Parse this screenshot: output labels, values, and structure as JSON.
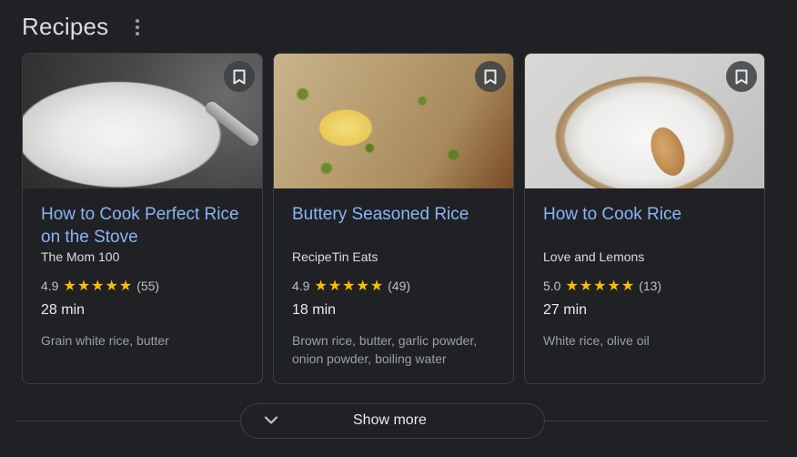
{
  "section": {
    "title": "Recipes"
  },
  "cards": [
    {
      "title": "How to Cook Perfect Rice on the Stove",
      "source": "The Mom 100",
      "rating": "4.9",
      "stars": "★★★★★",
      "reviews": "(55)",
      "time": "28 min",
      "ingredients": "Grain white rice, butter"
    },
    {
      "title": "Buttery Seasoned Rice",
      "source": "RecipeTin Eats",
      "rating": "4.9",
      "stars": "★★★★★",
      "reviews": "(49)",
      "time": "18 min",
      "ingredients": "Brown rice, butter, garlic powder, onion powder, boiling water"
    },
    {
      "title": "How to Cook Rice",
      "source": "Love and Lemons",
      "rating": "5.0",
      "stars": "★★★★★",
      "reviews": "(13)",
      "time": "27 min",
      "ingredients": "White rice, olive oil"
    }
  ],
  "show_more": {
    "label": "Show more"
  },
  "icons": {
    "more": "more-vert-icon",
    "bookmark": "bookmark-icon",
    "chevron": "chevron-down-icon"
  },
  "colors": {
    "background": "#202124",
    "link": "#8ab4f8",
    "star": "#fbbc04",
    "border": "#3c4043"
  }
}
